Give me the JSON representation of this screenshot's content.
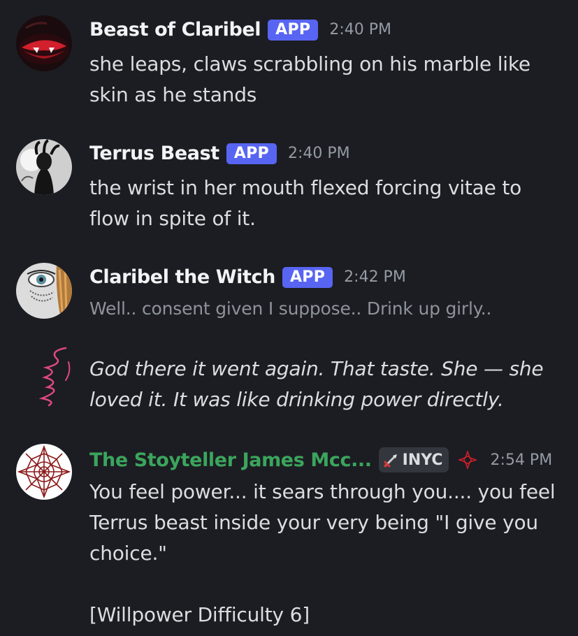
{
  "messages": [
    {
      "username": "Beast of Claribel",
      "badge": "APP",
      "time": "2:40 PM",
      "text": "she leaps, claws scrabbling on his marble like skin as he stands"
    },
    {
      "username": "Terrus Beast",
      "badge": "APP",
      "time": "2:40 PM",
      "text": "the wrist in her mouth flexed forcing vitae to flow in spite of it."
    },
    {
      "username": "Claribel the Witch",
      "badge": "APP",
      "time": "2:42 PM",
      "text": "Well.. consent given I suppose.. Drink up girly..",
      "continuation": "God there it went again. That taste. She — she loved it. It was like drinking power directly."
    },
    {
      "username": "The Stoyteller James Mcc...",
      "role_tag": "INYC",
      "time": "2:54 PM",
      "text": "You feel power... it sears through you.... you feel Terrus beast inside your very being \"I give you choice.\"",
      "text2": "[Willpower Difficulty 6]"
    }
  ],
  "colors": {
    "background": "#1c1d22",
    "app_badge": "#5865f2",
    "storyteller_name": "#3ba55d",
    "muted_text": "#8e939b",
    "doodle": "#e0487f"
  }
}
